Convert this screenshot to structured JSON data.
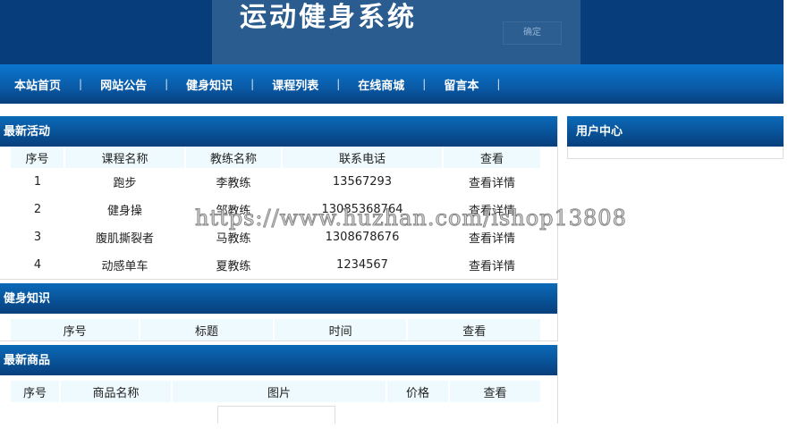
{
  "header": {
    "title": "运动健身系统",
    "confirm_label": "确定"
  },
  "nav": [
    "本站首页",
    "网站公告",
    "健身知识",
    "课程列表",
    "在线商城",
    "留言本"
  ],
  "activities": {
    "title": "最新活动",
    "columns": [
      "序号",
      "课程名称",
      "教练名称",
      "联系电话",
      "查看"
    ],
    "rows": [
      [
        "1",
        "跑步",
        "李教练",
        "13567293",
        "查看详情"
      ],
      [
        "2",
        "健身操",
        "邹教练",
        "13085368764",
        "查看详情"
      ],
      [
        "3",
        "腹肌撕裂者",
        "马教练",
        "1308678676",
        "查看详情"
      ],
      [
        "4",
        "动感单车",
        "夏教练",
        "1234567",
        "查看详情"
      ]
    ]
  },
  "knowledge": {
    "title": "健身知识",
    "columns": [
      "序号",
      "标题",
      "时间",
      "查看"
    ]
  },
  "products": {
    "title": "最新商品",
    "columns": [
      "序号",
      "商品名称",
      "图片",
      "价格",
      "查看"
    ]
  },
  "sidebar": {
    "title": "用户中心"
  },
  "watermark": "https://www.huzhan.com/ishop13808"
}
